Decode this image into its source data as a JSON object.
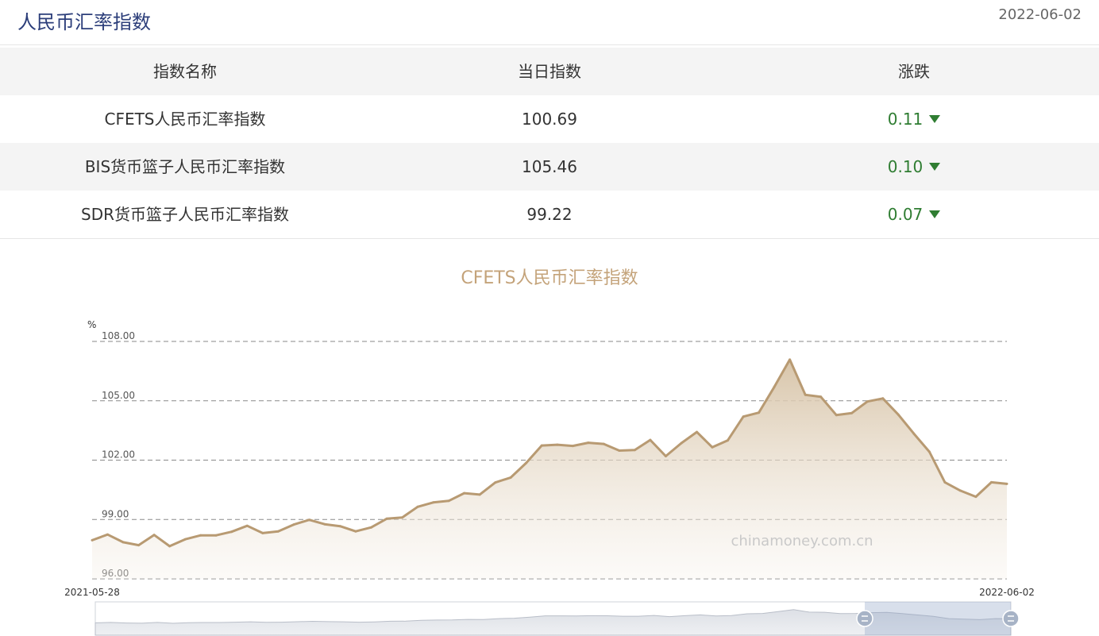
{
  "header": {
    "title": "人民币汇率指数",
    "date": "2022-06-02"
  },
  "table": {
    "columns": [
      "指数名称",
      "当日指数",
      "涨跌"
    ],
    "rows": [
      {
        "name": "CFETS人民币汇率指数",
        "value": "100.69",
        "change": "0.11",
        "direction": "down"
      },
      {
        "name": "BIS货币篮子人民币汇率指数",
        "value": "105.46",
        "change": "0.10",
        "direction": "down"
      },
      {
        "name": "SDR货币篮子人民币汇率指数",
        "value": "99.22",
        "change": "0.07",
        "direction": "down"
      }
    ]
  },
  "colors": {
    "line": "#b89a72",
    "area_top": "#d8c4a8",
    "down": "#2f7d32",
    "title_accent": "#c4a37a"
  },
  "chart_data": {
    "type": "area",
    "title": "CFETS人民币汇率指数",
    "ylabel": "%",
    "yticks": [
      "108.00",
      "105.00",
      "102.00",
      "99.00",
      "96.00"
    ],
    "ylim": [
      96,
      108
    ],
    "x_start_label": "2021-05-28",
    "x_end_label": "2022-06-02",
    "watermark": "chinamoney.com.cn",
    "grid": "dashed horizontal",
    "series": [
      {
        "values": [
          97.95,
          98.24,
          97.85,
          97.7,
          98.22,
          97.65,
          98.0,
          98.2,
          98.2,
          98.38,
          98.68,
          98.31,
          98.4,
          98.74,
          98.98,
          98.76,
          98.66,
          98.4,
          98.6,
          99.04,
          99.1,
          99.64,
          99.86,
          99.94,
          100.33,
          100.26,
          100.87,
          101.12,
          101.86,
          102.74,
          102.78,
          102.72,
          102.88,
          102.82,
          102.48,
          102.51,
          103.02,
          102.2,
          102.86,
          103.42,
          102.65,
          103.0,
          104.2,
          104.4,
          105.7,
          107.08,
          105.3,
          105.2,
          104.28,
          104.38,
          104.96,
          105.12,
          104.3,
          103.34,
          102.42,
          100.88,
          100.46,
          100.15,
          100.88,
          100.8
        ]
      }
    ]
  }
}
